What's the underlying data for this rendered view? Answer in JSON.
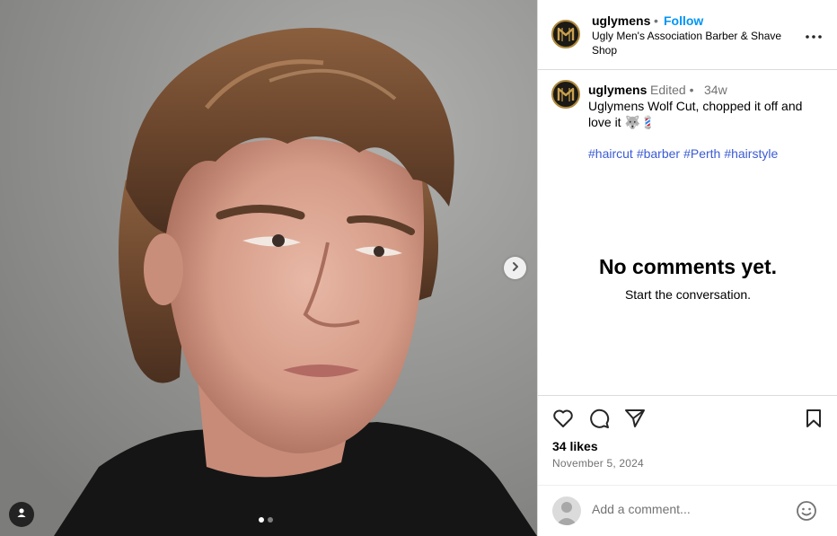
{
  "post": {
    "image_alt": "Portrait of a young man with a wolf cut hairstyle against a grey wall",
    "carousel": {
      "total": 2,
      "active": 1
    },
    "icons": {
      "next": "chevron-right-icon",
      "tag": "user-tag-icon"
    }
  },
  "header": {
    "username": "uglymens",
    "separator": "•",
    "follow_label": "Follow",
    "location": "Ugly Men's Association Barber & Shave Shop",
    "more_icon": "more-horizontal-icon"
  },
  "caption": {
    "username": "uglymens",
    "edited": "Edited •",
    "time": "34w",
    "text": "Uglymens Wolf Cut, chopped it off and love it 🐺💈",
    "hashtags": [
      "#haircut",
      "#barber",
      "#Perth",
      "#hairstyle"
    ]
  },
  "comments": {
    "empty_title": "No comments yet.",
    "empty_subtitle": "Start the conversation."
  },
  "actions": {
    "likes": "34 likes",
    "date": "November 5, 2024",
    "icons": [
      "heart-icon",
      "comment-icon",
      "share-icon",
      "bookmark-icon"
    ]
  },
  "comment_box": {
    "placeholder": "Add a comment...",
    "emoji_icon": "emoji-icon"
  },
  "colors": {
    "accent": "#0095f6",
    "hashtag": "#3b5bd6",
    "muted": "#737373",
    "border": "#dbdbdb",
    "logo_gold": "#b08a3c"
  }
}
